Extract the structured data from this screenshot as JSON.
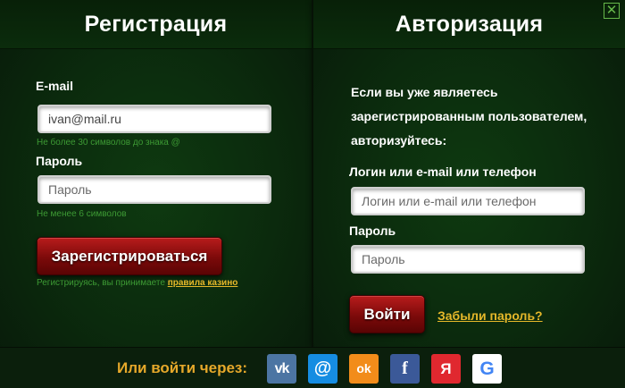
{
  "register": {
    "title": "Регистрация",
    "email_label": "E-mail",
    "email_value": "ivan@mail.ru",
    "email_hint": "Не более 30 символов до знака @",
    "password_label": "Пароль",
    "password_placeholder": "Пароль",
    "password_hint": "Не менее 6 символов",
    "submit_label": "Зарегистрироваться",
    "terms_prefix": "Регистрируясь, вы принимаете",
    "terms_link": "правила казино"
  },
  "login": {
    "title": "Авторизация",
    "intro": "Если вы уже являетесь зарегистрированным пользователем, авторизуйтесь:",
    "login_label": "Логин или e-mail или телефон",
    "login_placeholder": "Логин или e-mail или телефон",
    "password_label": "Пароль",
    "password_placeholder": "Пароль",
    "submit_label": "Войти",
    "forgot_label": "Забыли пароль?"
  },
  "footer": {
    "label": "Или войти через:",
    "socials": [
      {
        "name": "vk",
        "glyph": "vk",
        "color": "#4c75a3"
      },
      {
        "name": "mail",
        "glyph": "@",
        "color": "#168de2"
      },
      {
        "name": "odnoklassniki",
        "glyph": "ok",
        "color": "#f28c1a"
      },
      {
        "name": "facebook",
        "glyph": "f",
        "color": "#3b5998"
      },
      {
        "name": "yandex",
        "glyph": "Я",
        "color": "#e0282f"
      },
      {
        "name": "google",
        "glyph": "G",
        "color": "#ffffff"
      }
    ]
  },
  "close_glyph": "✕"
}
